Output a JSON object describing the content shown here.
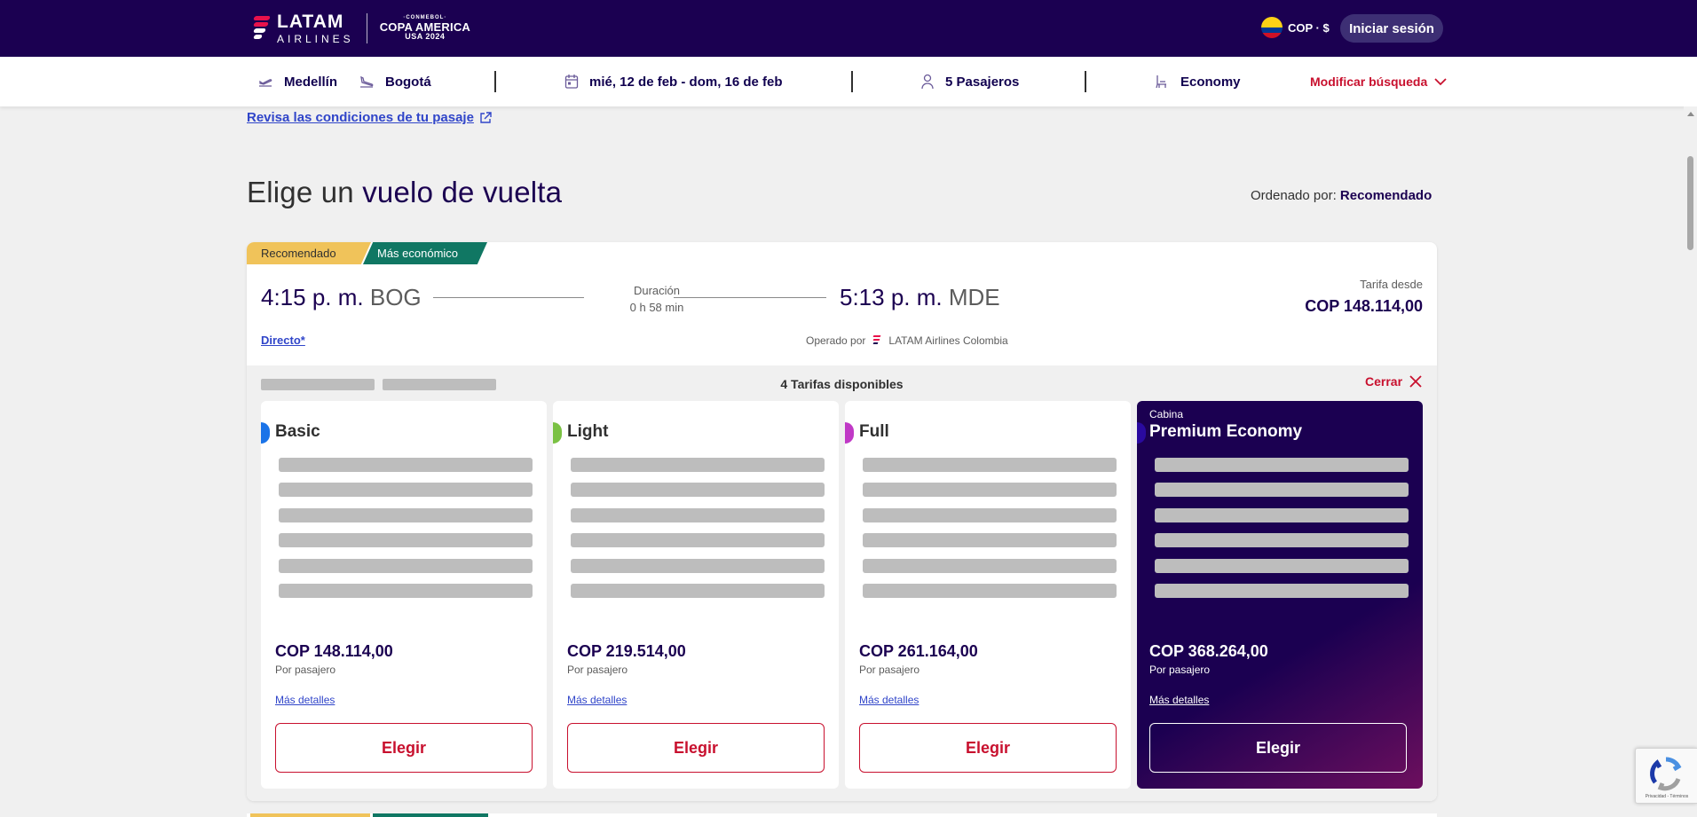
{
  "header": {
    "logo_main": "LATAM",
    "logo_sub": "AIRLINES",
    "copa_line1": "·CONMEBOL·",
    "copa_line2": "COPA AMERICA",
    "copa_line3": "USA 2024",
    "currency": "COP · $",
    "login_label": "Iniciar sesión"
  },
  "search": {
    "origin": "Medellín",
    "destination": "Bogotá",
    "dates": "mié, 12 de feb - dom, 16 de feb",
    "passengers": "5 Pasajeros",
    "cabin": "Economy",
    "modify_label": "Modificar búsqueda"
  },
  "page": {
    "conditions_link": "Revisa las condiciones de tu pasaje",
    "title_light": "Elige un",
    "title_strong": "vuelo de vuelta",
    "sort_label": "Ordenado por:",
    "sort_value": "Recomendado"
  },
  "flight": {
    "tag_recommended": "Recomendado",
    "tag_cheapest": "Más económico",
    "depart_time": "4:15 p. m.",
    "depart_code": "BOG",
    "duration_label": "Duración",
    "duration_value": "0 h 58 min",
    "arrive_time": "5:13 p. m.",
    "arrive_code": "MDE",
    "fare_from_label": "Tarifa desde",
    "fare_from_value": "COP 148.114,00",
    "direct_label": "Directo*",
    "operated_label": "Operado por",
    "operator": "LATAM Airlines Colombia"
  },
  "fares": {
    "count_label": "4 Tarifas disponibles",
    "close_label": "Cerrar",
    "items": [
      {
        "name": "Basic",
        "price": "COP 148.114,00",
        "per": "Por pasajero",
        "more": "Más detalles",
        "button": "Elegir",
        "accent": "#1a73e8"
      },
      {
        "name": "Light",
        "price": "COP 219.514,00",
        "per": "Por pasajero",
        "more": "Más detalles",
        "button": "Elegir",
        "accent": "#7ac143"
      },
      {
        "name": "Full",
        "price": "COP 261.164,00",
        "per": "Por pasajero",
        "more": "Más detalles",
        "button": "Elegir",
        "accent": "#c039c6"
      },
      {
        "name": "Premium Economy",
        "cabin": "Cabina",
        "price": "COP 368.264,00",
        "per": "Por pasajero",
        "more": "Más detalles",
        "button": "Elegir",
        "accent": "#2a0aa0"
      }
    ]
  },
  "recaptcha": {
    "footer": "Privacidad - Términos"
  },
  "colors": {
    "brand_dark": "#1b0051",
    "accent_red": "#c8102e",
    "link_blue": "#3045c9"
  }
}
